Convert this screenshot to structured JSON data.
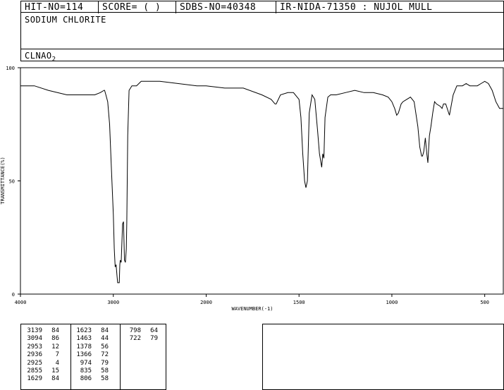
{
  "header": {
    "hit_no": "HIT-NO=114",
    "score": "SCORE=  (  )",
    "sdbs_no": "SDBS-NO=40348",
    "ir_id": "IR-NIDA-71350 : NUJOL MULL"
  },
  "compound_name": "SODIUM CHLORITE",
  "formula": {
    "main": "CLNAO",
    "subscript": "2"
  },
  "chart_data": {
    "type": "line",
    "title": "",
    "xlabel": "WAVENUMBER(-1)",
    "ylabel": "TRANSMITTANCE(%)",
    "xlim": [
      4000,
      400
    ],
    "ylim": [
      0,
      100
    ],
    "x_ticks": [
      4000,
      3000,
      2000,
      1500,
      1000,
      500
    ],
    "y_ticks": [
      0,
      50,
      100
    ],
    "grid": false,
    "series": [
      {
        "x": [
          4000,
          3850,
          3700,
          3500,
          3400,
          3200,
          3140,
          3100,
          3094,
          3080,
          3060,
          3040,
          3020,
          3000,
          2990,
          2980,
          2970,
          2960,
          2953,
          2945,
          2936,
          2930,
          2925,
          2915,
          2900,
          2890,
          2880,
          2870,
          2860,
          2855,
          2845,
          2830,
          2800,
          2750,
          2700,
          2650,
          2600,
          2500,
          2300,
          2100,
          2000,
          1900,
          1800,
          1700,
          1650,
          1629,
          1623,
          1600,
          1560,
          1530,
          1500,
          1490,
          1480,
          1470,
          1463,
          1455,
          1445,
          1430,
          1415,
          1400,
          1390,
          1378,
          1372,
          1366,
          1360,
          1345,
          1330,
          1300,
          1250,
          1200,
          1150,
          1100,
          1050,
          1020,
          1000,
          985,
          974,
          965,
          950,
          940,
          920,
          900,
          880,
          860,
          850,
          840,
          835,
          828,
          820,
          812,
          806,
          800,
          798,
          790,
          780,
          770,
          760,
          740,
          730,
          722,
          710,
          690,
          670,
          650,
          620,
          600,
          580,
          560,
          540,
          520,
          500,
          480,
          460,
          440,
          420,
          400
        ],
        "y": [
          92,
          92,
          90,
          88,
          88,
          88,
          89,
          90,
          90,
          88,
          85,
          75,
          55,
          35,
          20,
          12,
          13,
          8,
          5,
          5,
          5,
          13,
          15,
          14,
          31,
          32,
          15,
          14,
          20,
          32,
          70,
          90,
          92,
          92,
          94,
          94,
          94,
          94,
          93,
          92,
          92,
          91,
          91,
          88,
          86,
          84,
          84,
          88,
          89,
          89,
          86,
          78,
          62,
          50,
          47,
          50,
          80,
          88,
          86,
          72,
          62,
          56,
          62,
          60,
          78,
          87,
          88,
          88,
          89,
          90,
          89,
          89,
          88,
          87,
          85,
          82,
          79,
          80,
          84,
          85,
          86,
          87,
          85,
          74,
          65,
          61,
          61,
          63,
          69,
          62,
          58,
          67,
          70,
          74,
          80,
          85,
          84,
          83,
          82,
          84,
          84,
          79,
          88,
          92,
          92,
          93,
          92,
          92,
          92,
          93,
          94,
          93,
          90,
          85,
          82,
          82
        ]
      }
    ]
  },
  "peak_table": [
    [
      [
        "3139",
        "84"
      ],
      [
        "3094",
        "86"
      ],
      [
        "2953",
        "12"
      ],
      [
        "2936",
        "7"
      ],
      [
        "2925",
        "4"
      ],
      [
        "2855",
        "15"
      ],
      [
        "1629",
        "84"
      ]
    ],
    [
      [
        "1623",
        "84"
      ],
      [
        "1463",
        "44"
      ],
      [
        "1378",
        "56"
      ],
      [
        "1366",
        "72"
      ],
      [
        "974",
        "79"
      ],
      [
        "835",
        "58"
      ],
      [
        "806",
        "58"
      ]
    ],
    [
      [
        "798",
        "64"
      ],
      [
        "722",
        "79"
      ]
    ]
  ]
}
